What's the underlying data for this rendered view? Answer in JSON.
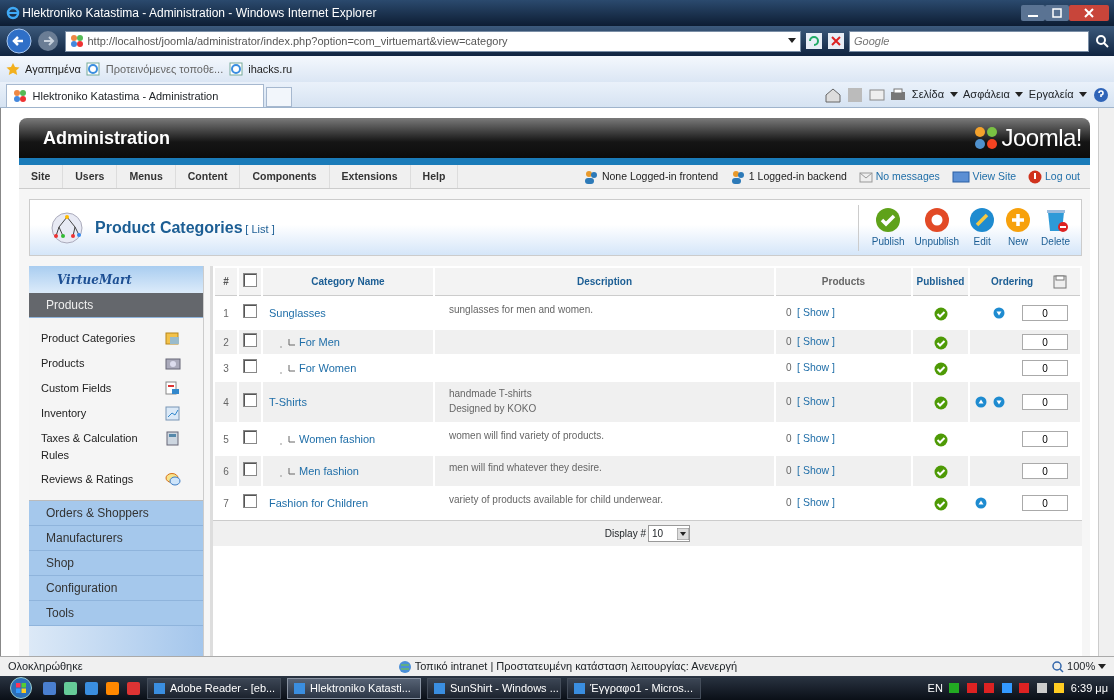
{
  "browser": {
    "title": "Hlektroniko Katastima - Administration - Windows Internet Explorer",
    "address": "http://localhost/joomla/administrator/index.php?option=com_virtuemart&view=category",
    "search_placeholder": "Google",
    "favorites_label": "Αγαπημένα",
    "favorites_links": [
      "Προτεινόμενες τοποθε...",
      "ihacks.ru"
    ],
    "tab_title": "Hlektroniko Katastima - Administration",
    "commands": [
      "Σελίδα",
      "Ασφάλεια",
      "Εργαλεία"
    ]
  },
  "admin": {
    "header_title": "Administration",
    "logo_text": "Joomla!",
    "menu": [
      "Site",
      "Users",
      "Menus",
      "Content",
      "Components",
      "Extensions",
      "Help"
    ],
    "status_links": [
      {
        "kind": "users",
        "text": "None Logged-in frontend"
      },
      {
        "kind": "users",
        "text": "1 Logged-in backend"
      },
      {
        "kind": "messages",
        "text": "No messages"
      },
      {
        "kind": "view-site",
        "text": "View Site"
      },
      {
        "kind": "logout",
        "text": "Log out"
      }
    ],
    "page_title": "Product Categories",
    "page_subtitle": "[ List ]",
    "toolbar": [
      {
        "kind": "publish",
        "label": "Publish"
      },
      {
        "kind": "unpublish",
        "label": "Unpublish"
      },
      {
        "kind": "edit",
        "label": "Edit"
      },
      {
        "kind": "new",
        "label": "New"
      },
      {
        "kind": "delete",
        "label": "Delete"
      }
    ],
    "sidebar": {
      "logo_text": "VirtueMart",
      "sections": [
        {
          "label": "Products",
          "expanded": true,
          "items": [
            "Product Categories",
            "Products",
            "Custom Fields",
            "Inventory",
            "Taxes & Calculation Rules",
            "Reviews & Ratings"
          ]
        },
        {
          "label": "Orders & Shoppers",
          "expanded": false
        },
        {
          "label": "Manufacturers",
          "expanded": false
        },
        {
          "label": "Shop",
          "expanded": false
        },
        {
          "label": "Configuration",
          "expanded": false
        },
        {
          "label": "Tools",
          "expanded": false
        }
      ]
    },
    "table": {
      "select_all_checked": false,
      "columns": [
        "#",
        "Category Name",
        "Description",
        "Products",
        "Published",
        "Ordering"
      ],
      "rows": [
        {
          "num": "1",
          "checked": false,
          "name": "Sunglasses",
          "description": [
            "sunglasses for men and women."
          ],
          "products": "0",
          "show": "[ Show ]",
          "published": true,
          "order_up": false,
          "order_down": true,
          "ordering": "0",
          "children": [
            {
              "num": "2",
              "checked": false,
              "name": "For Men",
              "products": "0",
              "show": "[ Show ]",
              "published": true,
              "order_up": false,
              "order_down": false,
              "ordering": "0"
            },
            {
              "num": "3",
              "checked": false,
              "name": "For Women",
              "products": "0",
              "show": "[ Show ]",
              "published": true,
              "order_up": false,
              "order_down": false,
              "ordering": "0"
            }
          ]
        },
        {
          "num": "4",
          "checked": false,
          "name": "T-Shirts",
          "description": [
            "handmade T-shirts",
            "Designed by KOKO"
          ],
          "products": "0",
          "show": "[ Show ]",
          "published": true,
          "order_up": true,
          "order_down": true,
          "ordering": "0",
          "children": [
            {
              "num": "5",
              "checked": false,
              "name": "Women fashion",
              "description": [
                "women will find variety of products."
              ],
              "products": "0",
              "show": "[ Show ]",
              "published": true,
              "order_up": false,
              "order_down": false,
              "ordering": "0"
            },
            {
              "num": "6",
              "checked": false,
              "name": "Men fashion",
              "description": [
                "men will find whatever they desire."
              ],
              "products": "0",
              "show": "[ Show ]",
              "published": true,
              "order_up": false,
              "order_down": false,
              "ordering": "0"
            }
          ]
        },
        {
          "num": "7",
          "checked": false,
          "name": "Fashion for Children",
          "description": [
            "variety of products available for child underwear."
          ],
          "products": "0",
          "show": "[ Show ]",
          "published": true,
          "order_up": true,
          "order_down": false,
          "ordering": "0"
        }
      ],
      "display_label": "Display #",
      "display_value": "10"
    }
  },
  "status_bar": {
    "text": "Ολοκληρώθηκε",
    "zone": "Τοπικό intranet | Προστατευμένη κατάσταση λειτουργίας: Ανενεργή",
    "zoom": "100%"
  },
  "taskbar": {
    "items": [
      {
        "text": "Adobe Reader - [eb...",
        "selected": false
      },
      {
        "text": "Hlektroniko Katasti...",
        "selected": true
      },
      {
        "text": "SunShirt - Windows ...",
        "selected": false
      },
      {
        "text": "Έγγραφο1 - Micros...",
        "selected": false
      }
    ],
    "language": "EN",
    "clock": "6:39 μμ"
  }
}
